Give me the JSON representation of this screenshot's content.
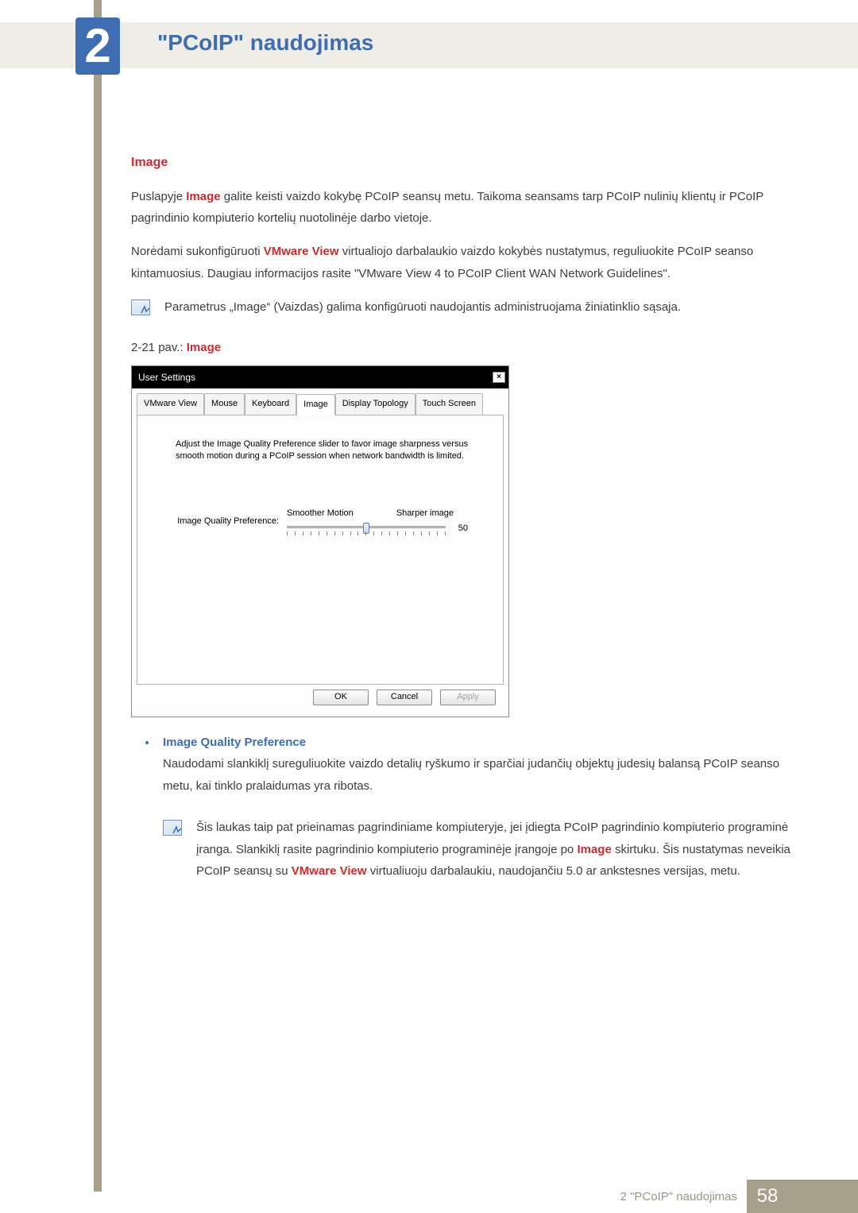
{
  "chapter": {
    "num": "2",
    "title": "\"PCoIP\" naudojimas"
  },
  "section": {
    "heading": "Image"
  },
  "para1_a": "Puslapyje ",
  "para1_hl": "Image",
  "para1_b": " galite keisti vaizdo kokybę PCoIP seansų metu. Taikoma seansams tarp PCoIP nulinių klientų ir PCoIP pagrindinio kompiuterio kortelių nuotolinėje darbo vietoje.",
  "para2_a": "Norėdami sukonfigūruoti ",
  "para2_hl": "VMware View",
  "para2_b": " virtualiojo darbalaukio vaizdo kokybės nustatymus, reguliuokite PCoIP seanso kintamuosius. Daugiau informacijos rasite \"VMware View 4 to PCoIP Client WAN Network Guidelines\".",
  "note1": "Parametrus „Image“ (Vaizdas) galima konfigūruoti naudojantis administruojama žiniatinklio sąsaja.",
  "fig_a": "2-21 pav.: ",
  "fig_hl": "Image",
  "dialog": {
    "title": "User Settings",
    "close": "×",
    "tabs": [
      "VMware View",
      "Mouse",
      "Keyboard",
      "Image",
      "Display Topology",
      "Touch Screen"
    ],
    "active_tab": 3,
    "instruction": "Adjust the Image Quality Preference slider to favor image sharpness versus smooth motion during a PCoIP session when network bandwidth is limited.",
    "pref_label": "Image Quality Preference:",
    "left_label": "Smoother Motion",
    "right_label": "Sharper image",
    "value": "50",
    "buttons": {
      "ok": "OK",
      "cancel": "Cancel",
      "apply": "Apply"
    }
  },
  "bullet": {
    "heading": "Image Quality Preference",
    "body": "Naudodami slankiklį sureguliuokite vaizdo detalių ryškumo ir sparčiai judančių objektų judesių balansą PCoIP seanso metu, kai tinklo pralaidumas yra ribotas."
  },
  "note2_a": "Šis laukas taip pat prieinamas pagrindiniame kompiuteryje, jei įdiegta PCoIP pagrindinio kompiuterio programinė įranga. Slankiklį rasite pagrindinio kompiuterio programinėje įrangoje po ",
  "note2_hl1": "Image",
  "note2_b": " skirtuku. Šis nustatymas neveikia PCoIP seansų su ",
  "note2_hl2": "VMware View",
  "note2_c": " virtualiuoju darbalaukiu, naudojančiu 5.0 ar ankstesnes versijas, metu.",
  "footer": {
    "text": "2 \"PCoIP\" naudojimas",
    "page": "58"
  }
}
